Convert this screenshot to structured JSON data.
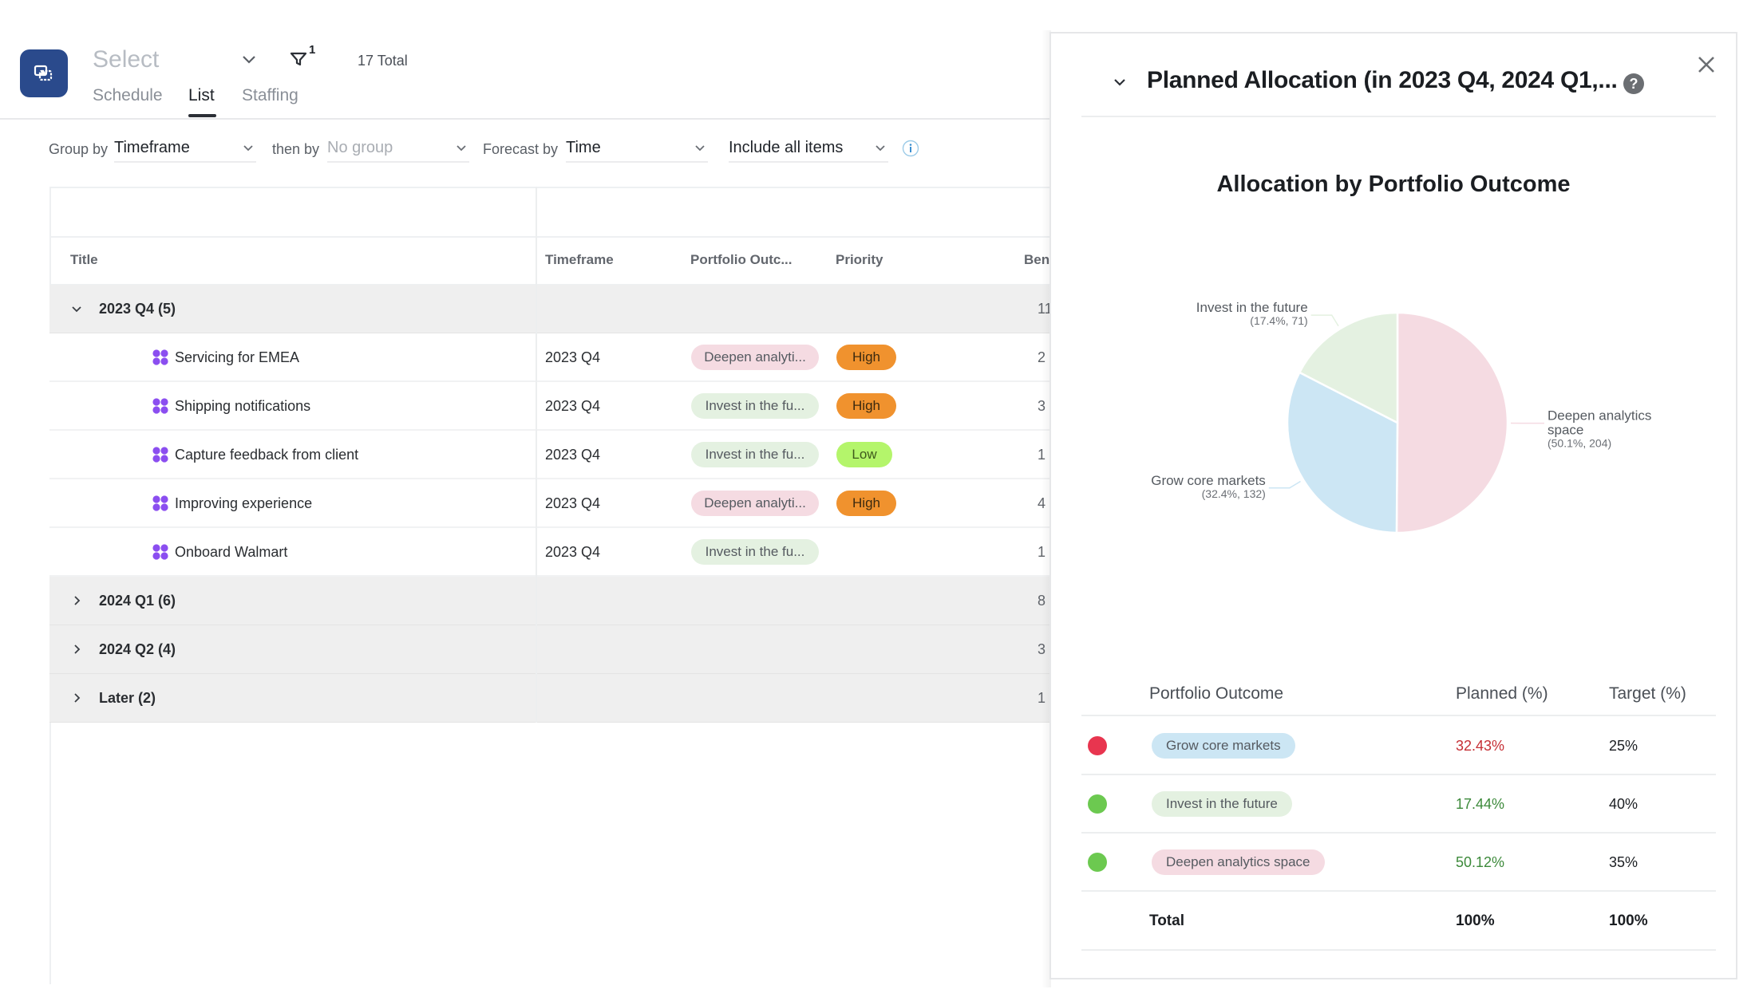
{
  "header": {
    "select_placeholder": "Select",
    "filter_count": "1",
    "total": "17 Total",
    "tabs": [
      {
        "label": "Schedule",
        "active": false
      },
      {
        "label": "List",
        "active": true
      },
      {
        "label": "Staffing",
        "active": false
      }
    ]
  },
  "toolbar": {
    "group_by_label": "Group by",
    "group_by_value": "Timeframe",
    "then_by_label": "then by",
    "then_by_placeholder": "No group",
    "forecast_by_label": "Forecast by",
    "forecast_by_value": "Time",
    "include_value": "Include all items"
  },
  "table": {
    "columns": [
      "Title",
      "Timeframe",
      "Portfolio Outc...",
      "Priority",
      "Ben"
    ],
    "groups": [
      {
        "label": "2023 Q4 (5)",
        "expanded": true,
        "ben": "11",
        "rows": [
          {
            "title": "Servicing for EMEA",
            "timeframe": "2023 Q4",
            "outcome": "Deepen analyti...",
            "outcome_type": "deepen",
            "priority": "High",
            "ben": "2"
          },
          {
            "title": "Shipping notifications",
            "timeframe": "2023 Q4",
            "outcome": "Invest in the fu...",
            "outcome_type": "invest",
            "priority": "High",
            "ben": "3"
          },
          {
            "title": "Capture feedback from client",
            "timeframe": "2023 Q4",
            "outcome": "Invest in the fu...",
            "outcome_type": "invest",
            "priority": "Low",
            "ben": "1"
          },
          {
            "title": "Improving experience",
            "timeframe": "2023 Q4",
            "outcome": "Deepen analyti...",
            "outcome_type": "deepen",
            "priority": "High",
            "ben": "4"
          },
          {
            "title": "Onboard Walmart",
            "timeframe": "2023 Q4",
            "outcome": "Invest in the fu...",
            "outcome_type": "invest",
            "priority": "",
            "ben": "1"
          }
        ]
      },
      {
        "label": "2024 Q1 (6)",
        "expanded": false,
        "ben": "8"
      },
      {
        "label": "2024 Q2 (4)",
        "expanded": false,
        "ben": "3"
      },
      {
        "label": "Later (2)",
        "expanded": false,
        "ben": "1"
      }
    ]
  },
  "panel": {
    "title": "Planned Allocation (in 2023 Q4, 2024 Q1,...",
    "help_glyph": "?",
    "alloc_table": {
      "headers": [
        "Portfolio Outcome",
        "Planned (%)",
        "Target (%)"
      ],
      "rows": [
        {
          "status": "off-target",
          "outcome": "Grow core markets",
          "planned": "32.43%",
          "target": "25%"
        },
        {
          "status": "on-target",
          "outcome": "Invest in the future",
          "planned": "17.44%",
          "target": "40%"
        },
        {
          "status": "on-target",
          "outcome": "Deepen analytics space",
          "planned": "50.12%",
          "target": "35%"
        }
      ],
      "total_label": "Total",
      "total_planned": "100%",
      "total_target": "100%"
    }
  },
  "colors": {
    "brand": "#2a4a8c",
    "grow": "#cce6f4",
    "invest": "#e4f1e1",
    "deepen": "#f5dbe2",
    "high": "#f0922e",
    "low": "#b4f56b",
    "status_red": "#e8354f",
    "status_green": "#6cc950",
    "planned_red": "#c62f35",
    "planned_green": "#3d8a3b"
  },
  "chart_data": {
    "type": "pie",
    "title": "Allocation by Portfolio Outcome",
    "slices": [
      {
        "label": "Deepen analytics space",
        "percent": 50.1,
        "value": 204,
        "sub": "(50.1%, 204)",
        "color": "#f5dbe2"
      },
      {
        "label": "Grow core markets",
        "percent": 32.4,
        "value": 132,
        "sub": "(32.4%, 132)",
        "color": "#cce6f4"
      },
      {
        "label": "Invest in the future",
        "percent": 17.4,
        "value": 71,
        "sub": "(17.4%, 71)",
        "color": "#e4f1e1"
      }
    ],
    "legend": "none",
    "start_angle": "12 o'clock, clockwise"
  }
}
